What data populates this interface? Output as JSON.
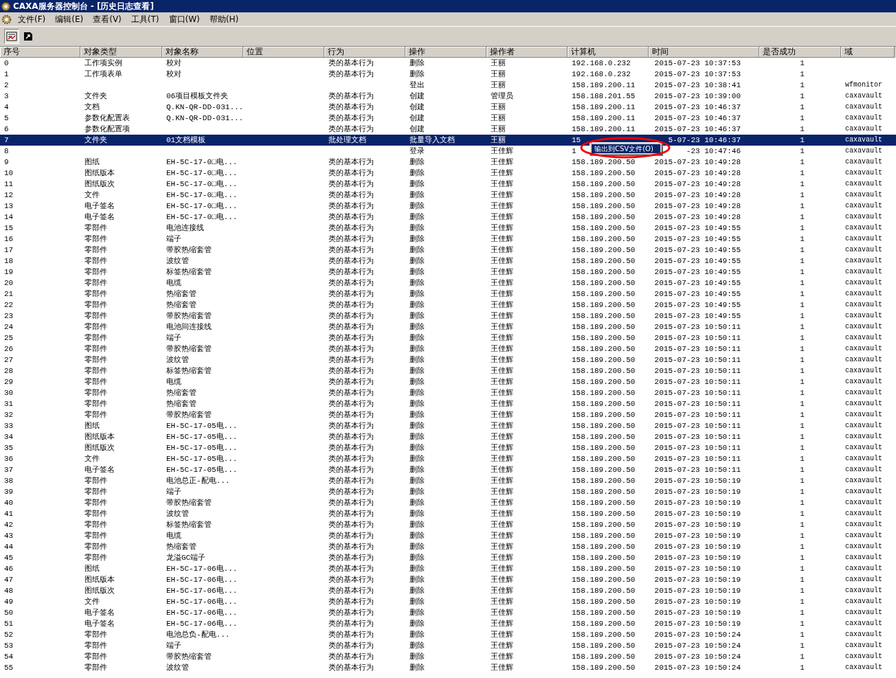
{
  "window": {
    "title": "CAXA服务器控制台 - [历史日志查看]"
  },
  "menu": [
    "文件(F)",
    "编辑(E)",
    "查看(V)",
    "工具(T)",
    "窗口(W)",
    "帮助(H)"
  ],
  "toolbar": [
    {
      "kind": "log",
      "selected": true
    },
    {
      "kind": "export",
      "selected": false
    }
  ],
  "table": {
    "columns": [
      "序号",
      "对象类型",
      "对象名称",
      "位置",
      "行为",
      "操作",
      "操作者",
      "计算机",
      "时间",
      "是否成功",
      "域"
    ],
    "rows": [
      {
        "no": "0",
        "object_type": "工作项实例",
        "object_name": "校对",
        "action": "类的基本行为",
        "operation": "删除",
        "operator": "王丽",
        "computer": "192.168.0.232",
        "time": "2015-07-23 10:37:53",
        "success": "1",
        "selected": false
      },
      {
        "no": "1",
        "object_type": "工作项表单",
        "object_name": "校对",
        "action": "类的基本行为",
        "operation": "删除",
        "operator": "王丽",
        "computer": "192.168.0.232",
        "time": "2015-07-23 10:37:53",
        "success": "1",
        "selected": false
      },
      {
        "no": "2",
        "operation": "登出",
        "operator": "王丽",
        "computer": "158.189.200.11",
        "time": "2015-07-23 10:38:41",
        "success": "1",
        "domain": "wfmonitor",
        "selected": false
      },
      {
        "no": "3",
        "object_type": "文件夹",
        "object_name": "06项目模板文件夹",
        "action": "类的基本行为",
        "operation": "创建",
        "operator": "管理员",
        "computer": "158.188.201.55",
        "time": "2015-07-23 10:39:00",
        "success": "1",
        "domain": "caxavault",
        "selected": false
      },
      {
        "no": "4",
        "object_type": "文档",
        "object_name": "Q.KN-QR-DD-031...",
        "action": "类的基本行为",
        "operation": "创建",
        "operator": "王丽",
        "computer": "158.189.200.11",
        "time": "2015-07-23 10:46:37",
        "success": "1",
        "domain": "caxavault",
        "selected": false
      },
      {
        "no": "5",
        "object_type": "参数化配置表",
        "object_name": "Q.KN-QR-DD-031...",
        "action": "类的基本行为",
        "operation": "创建",
        "operator": "王丽",
        "computer": "158.189.200.11",
        "time": "2015-07-23 10:46:37",
        "success": "1",
        "domain": "caxavault",
        "selected": false
      },
      {
        "no": "6",
        "object_type": "参数化配置项",
        "action": "类的基本行为",
        "operation": "创建",
        "operator": "王丽",
        "computer": "158.189.200.11",
        "time": "2015-07-23 10:46:37",
        "success": "1",
        "domain": "caxavault",
        "selected": false
      },
      {
        "no": "7",
        "object_type": "文件夹",
        "object_name": "01文档模板",
        "action": "批处理文档",
        "operation": "批量导入文档",
        "operator": "王丽",
        "computer": "15",
        "time": "5-07-23 10:46:37",
        "success": "1",
        "domain": "caxavault",
        "selected": true
      },
      {
        "no": "8",
        "operation": "登录",
        "operator": "王佳辉",
        "computer": "1",
        "time": "-23 10:47:46",
        "success": "1",
        "domain": "caxavault",
        "selected": false
      },
      {
        "no": "9",
        "object_type": "图纸",
        "object_name": "EH-5C-17-0□电...",
        "action": "类的基本行为",
        "operation": "删除",
        "operator": "王佳辉",
        "computer": "158.189.200.50",
        "time": "2015-07-23 10:49:28",
        "success": "1",
        "domain": "caxavault",
        "selected": false
      },
      {
        "no": "10",
        "object_type": "图纸版本",
        "object_name": "EH-5C-17-0□电...",
        "action": "类的基本行为",
        "operation": "删除",
        "operator": "王佳辉",
        "computer": "158.189.200.50",
        "time": "2015-07-23 10:49:28",
        "success": "1",
        "domain": "caxavault",
        "selected": false
      },
      {
        "no": "11",
        "object_type": "图纸版次",
        "object_name": "EH-5C-17-0□电...",
        "action": "类的基本行为",
        "operation": "删除",
        "operator": "王佳辉",
        "computer": "158.189.200.50",
        "time": "2015-07-23 10:49:28",
        "success": "1",
        "domain": "caxavault",
        "selected": false
      },
      {
        "no": "12",
        "object_type": "文件",
        "object_name": "EH-5C-17-0□电...",
        "action": "类的基本行为",
        "operation": "删除",
        "operator": "王佳辉",
        "computer": "158.189.200.50",
        "time": "2015-07-23 10:49:28",
        "success": "1",
        "domain": "caxavault",
        "selected": false
      },
      {
        "no": "13",
        "object_type": "电子签名",
        "object_name": "EH-5C-17-0□电...",
        "action": "类的基本行为",
        "operation": "删除",
        "operator": "王佳辉",
        "computer": "158.189.200.50",
        "time": "2015-07-23 10:49:28",
        "success": "1",
        "domain": "caxavault",
        "selected": false
      },
      {
        "no": "14",
        "object_type": "电子签名",
        "object_name": "EH-5C-17-0□电...",
        "action": "类的基本行为",
        "operation": "删除",
        "operator": "王佳辉",
        "computer": "158.189.200.50",
        "time": "2015-07-23 10:49:28",
        "success": "1",
        "domain": "caxavault",
        "selected": false
      },
      {
        "no": "15",
        "object_type": "零部件",
        "object_name": "电池连接线",
        "action": "类的基本行为",
        "operation": "删除",
        "operator": "王佳辉",
        "computer": "158.189.200.50",
        "time": "2015-07-23 10:49:55",
        "success": "1",
        "domain": "caxavault",
        "selected": false
      },
      {
        "no": "16",
        "object_type": "零部件",
        "object_name": "端子",
        "action": "类的基本行为",
        "operation": "删除",
        "operator": "王佳辉",
        "computer": "158.189.200.50",
        "time": "2015-07-23 10:49:55",
        "success": "1",
        "domain": "caxavault",
        "selected": false
      },
      {
        "no": "17",
        "object_type": "零部件",
        "object_name": "带胶热缩套管",
        "action": "类的基本行为",
        "operation": "删除",
        "operator": "王佳辉",
        "computer": "158.189.200.50",
        "time": "2015-07-23 10:49:55",
        "success": "1",
        "domain": "caxavault",
        "selected": false
      },
      {
        "no": "18",
        "object_type": "零部件",
        "object_name": "波纹管",
        "action": "类的基本行为",
        "operation": "删除",
        "operator": "王佳辉",
        "computer": "158.189.200.50",
        "time": "2015-07-23 10:49:55",
        "success": "1",
        "domain": "caxavault",
        "selected": false
      },
      {
        "no": "19",
        "object_type": "零部件",
        "object_name": "标签热缩套管",
        "action": "类的基本行为",
        "operation": "删除",
        "operator": "王佳辉",
        "computer": "158.189.200.50",
        "time": "2015-07-23 10:49:55",
        "success": "1",
        "domain": "caxavault",
        "selected": false
      },
      {
        "no": "20",
        "object_type": "零部件",
        "object_name": "电缆",
        "action": "类的基本行为",
        "operation": "删除",
        "operator": "王佳辉",
        "computer": "158.189.200.50",
        "time": "2015-07-23 10:49:55",
        "success": "1",
        "domain": "caxavault",
        "selected": false
      },
      {
        "no": "21",
        "object_type": "零部件",
        "object_name": "热缩套管",
        "action": "类的基本行为",
        "operation": "删除",
        "operator": "王佳辉",
        "computer": "158.189.200.50",
        "time": "2015-07-23 10:49:55",
        "success": "1",
        "domain": "caxavault",
        "selected": false
      },
      {
        "no": "22",
        "object_type": "零部件",
        "object_name": "热缩套管",
        "action": "类的基本行为",
        "operation": "删除",
        "operator": "王佳辉",
        "computer": "158.189.200.50",
        "time": "2015-07-23 10:49:55",
        "success": "1",
        "domain": "caxavault",
        "selected": false
      },
      {
        "no": "23",
        "object_type": "零部件",
        "object_name": "带胶热缩套管",
        "action": "类的基本行为",
        "operation": "删除",
        "operator": "王佳辉",
        "computer": "158.189.200.50",
        "time": "2015-07-23 10:49:55",
        "success": "1",
        "domain": "caxavault",
        "selected": false
      },
      {
        "no": "24",
        "object_type": "零部件",
        "object_name": "电池间连接线",
        "action": "类的基本行为",
        "operation": "删除",
        "operator": "王佳辉",
        "computer": "158.189.200.50",
        "time": "2015-07-23 10:50:11",
        "success": "1",
        "domain": "caxavault",
        "selected": false
      },
      {
        "no": "25",
        "object_type": "零部件",
        "object_name": "端子",
        "action": "类的基本行为",
        "operation": "删除",
        "operator": "王佳辉",
        "computer": "158.189.200.50",
        "time": "2015-07-23 10:50:11",
        "success": "1",
        "domain": "caxavault",
        "selected": false
      },
      {
        "no": "26",
        "object_type": "零部件",
        "object_name": "带胶热缩套管",
        "action": "类的基本行为",
        "operation": "删除",
        "operator": "王佳辉",
        "computer": "158.189.200.50",
        "time": "2015-07-23 10:50:11",
        "success": "1",
        "domain": "caxavault",
        "selected": false
      },
      {
        "no": "27",
        "object_type": "零部件",
        "object_name": "波纹管",
        "action": "类的基本行为",
        "operation": "删除",
        "operator": "王佳辉",
        "computer": "158.189.200.50",
        "time": "2015-07-23 10:50:11",
        "success": "1",
        "domain": "caxavault",
        "selected": false
      },
      {
        "no": "28",
        "object_type": "零部件",
        "object_name": "标签热缩套管",
        "action": "类的基本行为",
        "operation": "删除",
        "operator": "王佳辉",
        "computer": "158.189.200.50",
        "time": "2015-07-23 10:50:11",
        "success": "1",
        "domain": "caxavault",
        "selected": false
      },
      {
        "no": "29",
        "object_type": "零部件",
        "object_name": "电缆",
        "action": "类的基本行为",
        "operation": "删除",
        "operator": "王佳辉",
        "computer": "158.189.200.50",
        "time": "2015-07-23 10:50:11",
        "success": "1",
        "domain": "caxavault",
        "selected": false
      },
      {
        "no": "30",
        "object_type": "零部件",
        "object_name": "热缩套管",
        "action": "类的基本行为",
        "operation": "删除",
        "operator": "王佳辉",
        "computer": "158.189.200.50",
        "time": "2015-07-23 10:50:11",
        "success": "1",
        "domain": "caxavault",
        "selected": false
      },
      {
        "no": "31",
        "object_type": "零部件",
        "object_name": "热缩套管",
        "action": "类的基本行为",
        "operation": "删除",
        "operator": "王佳辉",
        "computer": "158.189.200.50",
        "time": "2015-07-23 10:50:11",
        "success": "1",
        "domain": "caxavault",
        "selected": false
      },
      {
        "no": "32",
        "object_type": "零部件",
        "object_name": "带胶热缩套管",
        "action": "类的基本行为",
        "operation": "删除",
        "operator": "王佳辉",
        "computer": "158.189.200.50",
        "time": "2015-07-23 10:50:11",
        "success": "1",
        "domain": "caxavault",
        "selected": false
      },
      {
        "no": "33",
        "object_type": "图纸",
        "object_name": "EH-5C-17-05电...",
        "action": "类的基本行为",
        "operation": "删除",
        "operator": "王佳辉",
        "computer": "158.189.200.50",
        "time": "2015-07-23 10:50:11",
        "success": "1",
        "domain": "caxavault",
        "selected": false
      },
      {
        "no": "34",
        "object_type": "图纸版本",
        "object_name": "EH-5C-17-05电...",
        "action": "类的基本行为",
        "operation": "删除",
        "operator": "王佳辉",
        "computer": "158.189.200.50",
        "time": "2015-07-23 10:50:11",
        "success": "1",
        "domain": "caxavault",
        "selected": false
      },
      {
        "no": "35",
        "object_type": "图纸版次",
        "object_name": "EH-5C-17-05电...",
        "action": "类的基本行为",
        "operation": "删除",
        "operator": "王佳辉",
        "computer": "158.189.200.50",
        "time": "2015-07-23 10:50:11",
        "success": "1",
        "domain": "caxavault",
        "selected": false
      },
      {
        "no": "36",
        "object_type": "文件",
        "object_name": "EH-5C-17-05电...",
        "action": "类的基本行为",
        "operation": "删除",
        "operator": "王佳辉",
        "computer": "158.189.200.50",
        "time": "2015-07-23 10:50:11",
        "success": "1",
        "domain": "caxavault",
        "selected": false
      },
      {
        "no": "37",
        "object_type": "电子签名",
        "object_name": "EH-5C-17-05电...",
        "action": "类的基本行为",
        "operation": "删除",
        "operator": "王佳辉",
        "computer": "158.189.200.50",
        "time": "2015-07-23 10:50:11",
        "success": "1",
        "domain": "caxavault",
        "selected": false
      },
      {
        "no": "38",
        "object_type": "零部件",
        "object_name": "电池总正-配电...",
        "action": "类的基本行为",
        "operation": "删除",
        "operator": "王佳辉",
        "computer": "158.189.200.50",
        "time": "2015-07-23 10:50:19",
        "success": "1",
        "domain": "caxavault",
        "selected": false
      },
      {
        "no": "39",
        "object_type": "零部件",
        "object_name": "端子",
        "action": "类的基本行为",
        "operation": "删除",
        "operator": "王佳辉",
        "computer": "158.189.200.50",
        "time": "2015-07-23 10:50:19",
        "success": "1",
        "domain": "caxavault",
        "selected": false
      },
      {
        "no": "40",
        "object_type": "零部件",
        "object_name": "带胶热缩套管",
        "action": "类的基本行为",
        "operation": "删除",
        "operator": "王佳辉",
        "computer": "158.189.200.50",
        "time": "2015-07-23 10:50:19",
        "success": "1",
        "domain": "caxavault",
        "selected": false
      },
      {
        "no": "41",
        "object_type": "零部件",
        "object_name": "波纹管",
        "action": "类的基本行为",
        "operation": "删除",
        "operator": "王佳辉",
        "computer": "158.189.200.50",
        "time": "2015-07-23 10:50:19",
        "success": "1",
        "domain": "caxavault",
        "selected": false
      },
      {
        "no": "42",
        "object_type": "零部件",
        "object_name": "标签热缩套管",
        "action": "类的基本行为",
        "operation": "删除",
        "operator": "王佳辉",
        "computer": "158.189.200.50",
        "time": "2015-07-23 10:50:19",
        "success": "1",
        "domain": "caxavault",
        "selected": false
      },
      {
        "no": "43",
        "object_type": "零部件",
        "object_name": "电缆",
        "action": "类的基本行为",
        "operation": "删除",
        "operator": "王佳辉",
        "computer": "158.189.200.50",
        "time": "2015-07-23 10:50:19",
        "success": "1",
        "domain": "caxavault",
        "selected": false
      },
      {
        "no": "44",
        "object_type": "零部件",
        "object_name": "热缩套管",
        "action": "类的基本行为",
        "operation": "删除",
        "operator": "王佳辉",
        "computer": "158.189.200.50",
        "time": "2015-07-23 10:50:19",
        "success": "1",
        "domain": "caxavault",
        "selected": false
      },
      {
        "no": "45",
        "object_type": "零部件",
        "object_name": "龙溢GC端子",
        "action": "类的基本行为",
        "operation": "删除",
        "operator": "王佳辉",
        "computer": "158.189.200.50",
        "time": "2015-07-23 10:50:19",
        "success": "1",
        "domain": "caxavault",
        "selected": false
      },
      {
        "no": "46",
        "object_type": "图纸",
        "object_name": "EH-5C-17-06电...",
        "action": "类的基本行为",
        "operation": "删除",
        "operator": "王佳辉",
        "computer": "158.189.200.50",
        "time": "2015-07-23 10:50:19",
        "success": "1",
        "domain": "caxavault",
        "selected": false
      },
      {
        "no": "47",
        "object_type": "图纸版本",
        "object_name": "EH-5C-17-06电...",
        "action": "类的基本行为",
        "operation": "删除",
        "operator": "王佳辉",
        "computer": "158.189.200.50",
        "time": "2015-07-23 10:50:19",
        "success": "1",
        "domain": "caxavault",
        "selected": false
      },
      {
        "no": "48",
        "object_type": "图纸版次",
        "object_name": "EH-5C-17-06电...",
        "action": "类的基本行为",
        "operation": "删除",
        "operator": "王佳辉",
        "computer": "158.189.200.50",
        "time": "2015-07-23 10:50:19",
        "success": "1",
        "domain": "caxavault",
        "selected": false
      },
      {
        "no": "49",
        "object_type": "文件",
        "object_name": "EH-5C-17-06电...",
        "action": "类的基本行为",
        "operation": "删除",
        "operator": "王佳辉",
        "computer": "158.189.200.50",
        "time": "2015-07-23 10:50:19",
        "success": "1",
        "domain": "caxavault",
        "selected": false
      },
      {
        "no": "50",
        "object_type": "电子签名",
        "object_name": "EH-5C-17-06电...",
        "action": "类的基本行为",
        "operation": "删除",
        "operator": "王佳辉",
        "computer": "158.189.200.50",
        "time": "2015-07-23 10:50:19",
        "success": "1",
        "domain": "caxavault",
        "selected": false
      },
      {
        "no": "51",
        "object_type": "电子签名",
        "object_name": "EH-5C-17-06电...",
        "action": "类的基本行为",
        "operation": "删除",
        "operator": "王佳辉",
        "computer": "158.189.200.50",
        "time": "2015-07-23 10:50:19",
        "success": "1",
        "domain": "caxavault",
        "selected": false
      },
      {
        "no": "52",
        "object_type": "零部件",
        "object_name": "电池总负-配电...",
        "action": "类的基本行为",
        "operation": "删除",
        "operator": "王佳辉",
        "computer": "158.189.200.50",
        "time": "2015-07-23 10:50:24",
        "success": "1",
        "domain": "caxavault",
        "selected": false
      },
      {
        "no": "53",
        "object_type": "零部件",
        "object_name": "端子",
        "action": "类的基本行为",
        "operation": "删除",
        "operator": "王佳辉",
        "computer": "158.189.200.50",
        "time": "2015-07-23 10:50:24",
        "success": "1",
        "domain": "caxavault",
        "selected": false
      },
      {
        "no": "54",
        "object_type": "零部件",
        "object_name": "带胶热缩套管",
        "action": "类的基本行为",
        "operation": "删除",
        "operator": "王佳辉",
        "computer": "158.189.200.50",
        "time": "2015-07-23 10:50:24",
        "success": "1",
        "domain": "caxavault",
        "selected": false
      },
      {
        "no": "55",
        "object_type": "零部件",
        "object_name": "波纹管",
        "action": "类的基本行为",
        "operation": "删除",
        "operator": "王佳辉",
        "computer": "158.189.200.50",
        "time": "2015-07-23 10:50:24",
        "success": "1",
        "domain": "caxavault",
        "selected": false
      }
    ]
  },
  "context_menu": {
    "items": [
      {
        "label": "输出到CSV文件(O)",
        "selected": true
      }
    ]
  }
}
